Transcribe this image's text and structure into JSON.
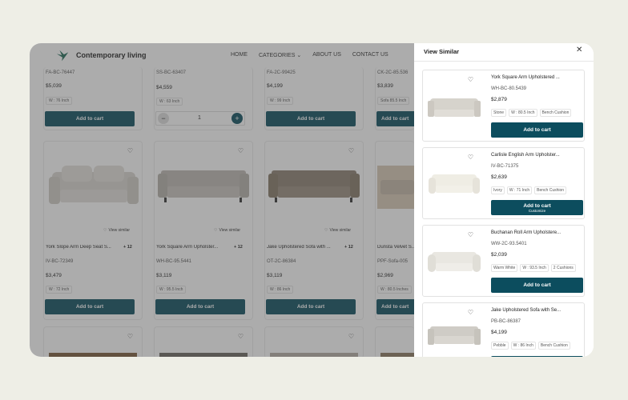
{
  "header": {
    "brand": "Contemporary living",
    "nav": [
      "HOME",
      "CATEGORIES",
      "ABOUT US",
      "CONTACT US"
    ]
  },
  "top_row": [
    {
      "sku": "FA-BC-76447",
      "price": "$5,039",
      "chip": "W : 76 Inch",
      "action": "Add to cart"
    },
    {
      "sku": "SS-BC-63407",
      "price": "$4,559",
      "chip": "W : 63 Inch",
      "qty": "1"
    },
    {
      "sku": "FA-2C-99425",
      "price": "$4,199",
      "chip": "W : 99 Inch",
      "action": "Add to cart"
    },
    {
      "sku": "CK-2C-85.536",
      "price": "$3,839",
      "chip": "Sofa  85.5 Inch",
      "action": "Add to cart"
    }
  ],
  "mid_row": [
    {
      "name": "York Slope Arm Deep Seat S...",
      "sku": "IV-BC-72349",
      "price": "$3,479",
      "chip": "W : 72 Inch",
      "more": "+ 12",
      "similar": "View similar",
      "action": "Add to cart"
    },
    {
      "name": "York Square Arm Upholster...",
      "sku": "WH-BC-95.5441",
      "price": "$3,119",
      "chip": "W : 95.5 Inch",
      "more": "+ 12",
      "similar": "View similar",
      "action": "Add to cart"
    },
    {
      "name": "Jake Upholstered Sofa with ...",
      "sku": "OT-2C-86384",
      "price": "$3,119",
      "chip": "W : 86 Inch",
      "more": "+ 12",
      "similar": "View similar",
      "action": "Add to cart"
    },
    {
      "name": "Dunsta Velvet S...",
      "sku": "PPF-Sofa-005",
      "price": "$2,969",
      "chip": "W : 80.5 Inches",
      "action": "Add to cart"
    }
  ],
  "panel": {
    "title": "View Similar",
    "items": [
      {
        "name": "York Square Arm Upholstered ...",
        "sku": "WH-BC-80.5439",
        "price": "$2,879",
        "chips": [
          "Stone",
          "W : 80.5 Inch",
          "Bench Cushion"
        ],
        "action": "Add to cart",
        "sub": ""
      },
      {
        "name": "Carlisle English Arm Upholster...",
        "sku": "IV-BC-71375",
        "price": "$2,639",
        "chips": [
          "Ivory",
          "W : 71 Inch",
          "Bench Cushion"
        ],
        "action": "Add to cart",
        "sub": "Customize"
      },
      {
        "name": "Buchanan Roll Arm Upholstere...",
        "sku": "WW-2C-93.5401",
        "price": "$2,039",
        "chips": [
          "Warm White",
          "W : 93.5 Inch",
          "2 Cushions"
        ],
        "action": "Add to cart",
        "sub": ""
      },
      {
        "name": "Jake Upholstered Sofa with Se...",
        "sku": "PB-BC-86387",
        "price": "$4,199",
        "chips": [
          "Pebble",
          "W : 86 Inch",
          "Bench Cushion"
        ],
        "action": "",
        "sub": ""
      }
    ]
  },
  "colors": {
    "accent": "#0c4d5e",
    "background": "#eeeee6"
  }
}
